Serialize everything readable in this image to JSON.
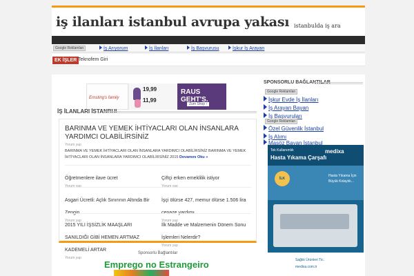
{
  "header": {
    "site_title": "iş ilanları istanbul avrupa yakası",
    "tagline": "istanbulda iş ara"
  },
  "linkbar": {
    "ad_tag": "Google Reklamları",
    "links": [
      "İş Arıyorum",
      "İş İlanları",
      "İş Başvurusu",
      "İşkur İş Arayan"
    ]
  },
  "breaking": {
    "label": "EK İŞLER",
    "text": "Teknofem Giri"
  },
  "promo": {
    "brand": "Ernsting's family",
    "price1": "19,99",
    "price2": "11,99",
    "headline": "RAUS GEHT'S.",
    "cta": "Zum Shop ›"
  },
  "main": {
    "section_title": "İŞ İLANLARI İSTANBUL",
    "featured": {
      "title": "BARINMA VE YEMEK İHTİYACLARI OLAN İNSANLARA YARDIMCI OLABİLİRSİNİZ",
      "meta": "Yorum yap",
      "excerpt": "BARINMA VE YEMEK İHTİYACLARI OLAN İNSANLARA YARDIMCI OLABİLİRSİNİZ BARINMA VE YEMEK İHTİYACLARI OLAN İNSANLARA YARDIMCI OLABİLİRSİNİZ  2015",
      "more": "Devamını Oku »"
    },
    "items": [
      {
        "title": "Öğretmenlere ilave ücret",
        "meta": "Yorum yap"
      },
      {
        "title": "Çiftçi erken emeklilik istiyor",
        "meta": "Yorum yap"
      },
      {
        "title": "Asgari Ücretli: Açlık Sınırının Altında Bir Zengin",
        "meta": "Yorum yap"
      },
      {
        "title": "İşçi ölürse 427, memur ölürse 1.506 lira cenaze yardımı",
        "meta": "Yorum yap"
      },
      {
        "title": "2015 YILI İŞSİZLİK MAAŞLARI SANILDIĞI GİBİ HEMEN ARTMAZ KADEMELİ ARTAR",
        "meta": "Yorum yap"
      },
      {
        "title": "İlk Madde ve Malzemenin Dönem Sonu İşlemleri Nelerdir?",
        "meta": "Yorum yap"
      }
    ],
    "sponsored_label": "Sponsorlu Bağlantılar",
    "bottom_ad": "Emprego no Estrangeiro"
  },
  "sidebar": {
    "title": "SPONSORLU BAĞLANTILAR",
    "ad_tag": "Google Reklamları",
    "links_a": [
      "İşkur Evde İş İlanları",
      "İş Arayan Bayan",
      "İş Başvuruları"
    ],
    "links_b": [
      "Özel Güvenlik İstanbul",
      "İş Alımı",
      "Masöz Bayan İstanbul"
    ],
    "hospital_ad": {
      "line1": "Tek Kullanımlık",
      "line2": "Hasta Yıkama Çarşafı",
      "logo": "medixa",
      "badge": "İLK",
      "mid1": "Hasta Yıkama İçin",
      "mid2": "Büyük Kolaylık...",
      "foot1": "Sağlık Ürünleri Tic.",
      "foot2": "medixa.com.tr"
    }
  },
  "colors": {
    "accent": "#f39c12",
    "link": "#1a3fa8",
    "breaking": "#c0392b",
    "dark_bar": "#2b2b2b"
  }
}
